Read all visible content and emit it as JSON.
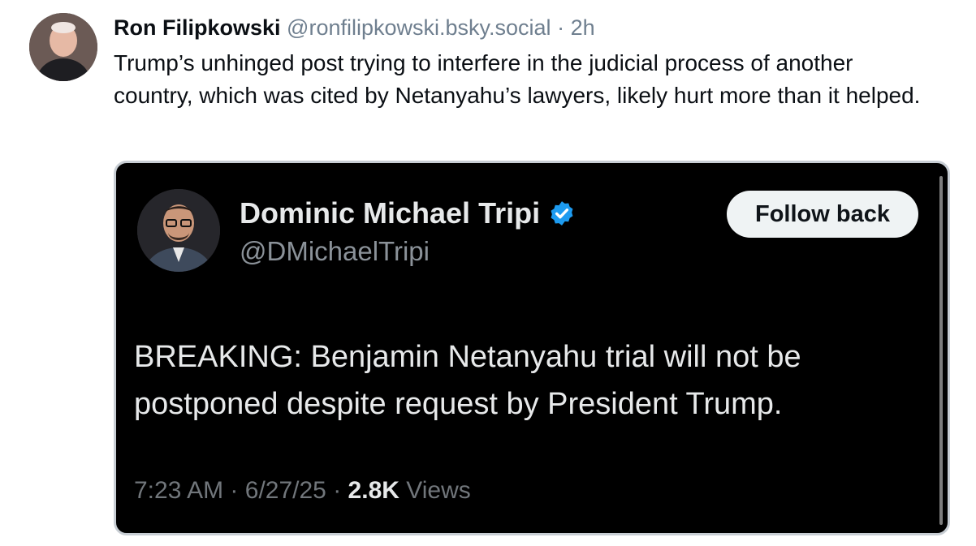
{
  "post": {
    "author_name": "Ron Filipkowski",
    "handle": "@ronfilipkowski.bsky.social",
    "separator": "·",
    "time": "2h",
    "text": "Trump’s unhinged post trying to interfere in the judicial process of another country, which was cited by Netanyahu’s lawyers, likely hurt more than it helped."
  },
  "embed": {
    "name": "Dominic Michael Tripi",
    "handle": "@DMichaelTripi",
    "follow_label": "Follow back",
    "text": "BREAKING: Benjamin Netanyahu trial will not be postponed despite request by President Trump.",
    "time": "7:23 AM",
    "sep1": "·",
    "date": "6/27/25",
    "sep2": "·",
    "views_count": "2.8K",
    "views_label": "Views"
  },
  "icons": {
    "author_avatar": "avatar",
    "embed_avatar": "avatar",
    "verified": "verified-badge-icon"
  },
  "colors": {
    "embed_background": "#000000",
    "verified_badge": "#1d9bf0",
    "follow_button": "#eff3f4",
    "muted_text": "#6f7f8f"
  }
}
